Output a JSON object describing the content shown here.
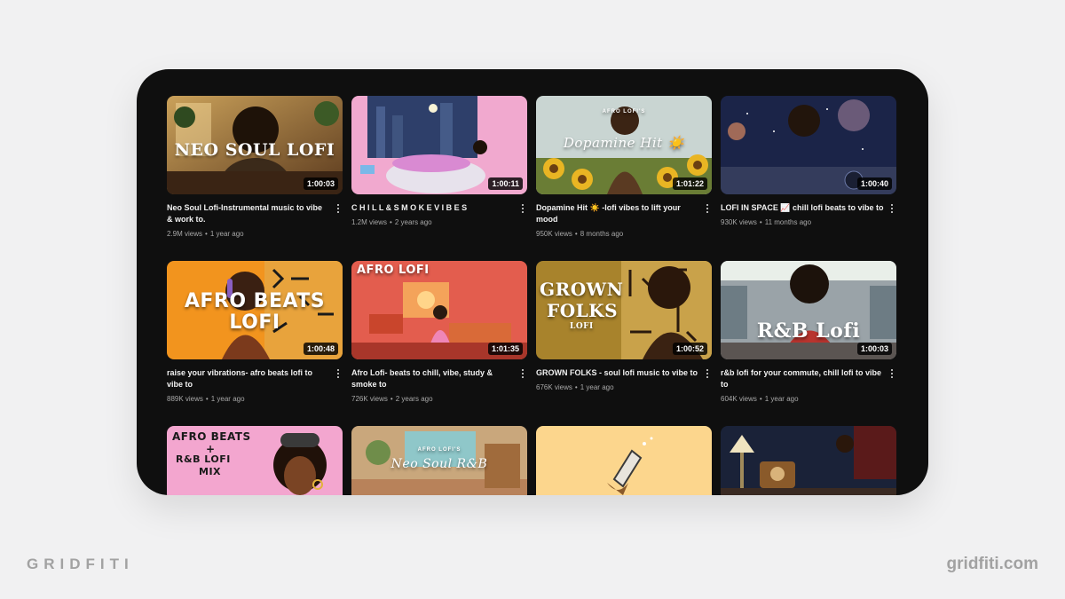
{
  "videos": [
    {
      "title": "Neo Soul Lofi-Instrumental music to vibe & work to.",
      "views": "2.9M views",
      "age": "1 year ago",
      "duration": "1:00:03",
      "thumb_text": "NEO SOUL LOFI"
    },
    {
      "title": "C H I L L & S M O K E V I B E S",
      "views": "1.2M views",
      "age": "2 years ago",
      "duration": "1:00:11",
      "thumb_text": ""
    },
    {
      "title": "Dopamine Hit ☀️ -lofi vibes to lift your mood",
      "views": "950K views",
      "age": "8 months ago",
      "duration": "1:01:22",
      "thumb_text": "Dopamine Hit ☀️",
      "thumb_small": "AFRO LOFI'S"
    },
    {
      "title": "LOFI IN SPACE 📈 chill lofi beats to vibe to",
      "views": "930K views",
      "age": "11 months ago",
      "duration": "1:00:40",
      "thumb_text": ""
    },
    {
      "title": "raise your vibrations- afro beats lofi to vibe to",
      "views": "889K views",
      "age": "1 year ago",
      "duration": "1:00:48",
      "thumb_text": "AFRO BEATS",
      "thumb_text2": "LOFI"
    },
    {
      "title": "Afro Lofi- beats to chill, vibe, study & smoke to",
      "views": "726K views",
      "age": "2 years ago",
      "duration": "1:01:35",
      "thumb_text": "AFRO LOFI"
    },
    {
      "title": "GROWN FOLKS - soul lofi music to vibe to",
      "views": "676K views",
      "age": "1 year ago",
      "duration": "1:00:52",
      "thumb_text": "GROWN",
      "thumb_text2": "FOLKS",
      "thumb_small": "LOFI"
    },
    {
      "title": "r&b lofi for your commute, chill lofi to vibe to",
      "views": "604K views",
      "age": "1 year ago",
      "duration": "1:00:03",
      "thumb_text": "R&B Lofi"
    },
    {
      "thumb_text": "AFRO BEATS",
      "thumb_text2": "+",
      "thumb_small": "R&B LOFI",
      "thumb_small2": "MIX"
    },
    {
      "thumb_text": "Neo Soul R&B",
      "thumb_small": "AFRO LOFI'S"
    },
    {
      "thumb_text": ""
    },
    {
      "thumb_text": ""
    }
  ],
  "colors": {
    "panel": "#0f0f0f",
    "page": "#f1f1f2",
    "meta_text": "#a8a8a8",
    "title_text": "#f1f1f1"
  },
  "icons": [
    "more-vert-icon"
  ],
  "brand": {
    "left": "GRIDFITI",
    "right": "gridfiti.com"
  }
}
